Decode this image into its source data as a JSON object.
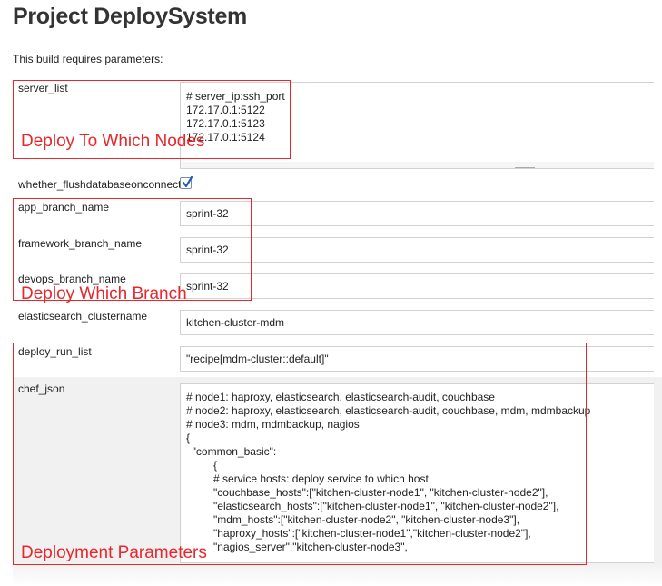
{
  "page": {
    "title": "Project DeploySystem",
    "subtitle": "This build requires parameters:"
  },
  "params": {
    "server_list": {
      "label": "server_list",
      "value": "# server_ip:ssh_port\n172.17.0.1:5122\n172.17.0.1:5123\n172.17.0.1:5124"
    },
    "flush_db": {
      "label": "whether_flushdatabaseonconnect",
      "checked": true
    },
    "app_branch": {
      "label": "app_branch_name",
      "value": "sprint-32"
    },
    "framework_branch": {
      "label": "framework_branch_name",
      "value": "sprint-32"
    },
    "devops_branch": {
      "label": "devops_branch_name",
      "value": "sprint-32"
    },
    "es_cluster": {
      "label": "elasticsearch_clustername",
      "value": "kitchen-cluster-mdm"
    },
    "deploy_run_list": {
      "label": "deploy_run_list",
      "value": "\"recipe[mdm-cluster::default]\""
    },
    "chef_json": {
      "label": "chef_json",
      "value": "# node1: haproxy, elasticsearch, elasticsearch-audit, couchbase\n# node2: haproxy, elasticsearch, elasticsearch-audit, couchbase, mdm, mdmbackup\n# node3: mdm, mdmbackup, nagios\n{\n  \"common_basic\":\n         {\n         # service hosts: deploy service to which host\n         \"couchbase_hosts\":[\"kitchen-cluster-node1\", \"kitchen-cluster-node2\"],\n         \"elasticsearch_hosts\":[\"kitchen-cluster-node1\", \"kitchen-cluster-node2\"],\n         \"mdm_hosts\":[\"kitchen-cluster-node2\", \"kitchen-cluster-node3\"],\n         \"haproxy_hosts\":[\"kitchen-cluster-node1\",\"kitchen-cluster-node2\"],\n         \"nagios_server\":\"kitchen-cluster-node3\","
    }
  },
  "annotations": {
    "nodes": "Deploy To Which Nodes",
    "branch": "Deploy Which Branch",
    "parameters": "Deployment Parameters"
  },
  "colors": {
    "annotation": "#e8262b",
    "row_highlight": "#f1f1f1",
    "checkbox_check": "#2a5db0"
  }
}
